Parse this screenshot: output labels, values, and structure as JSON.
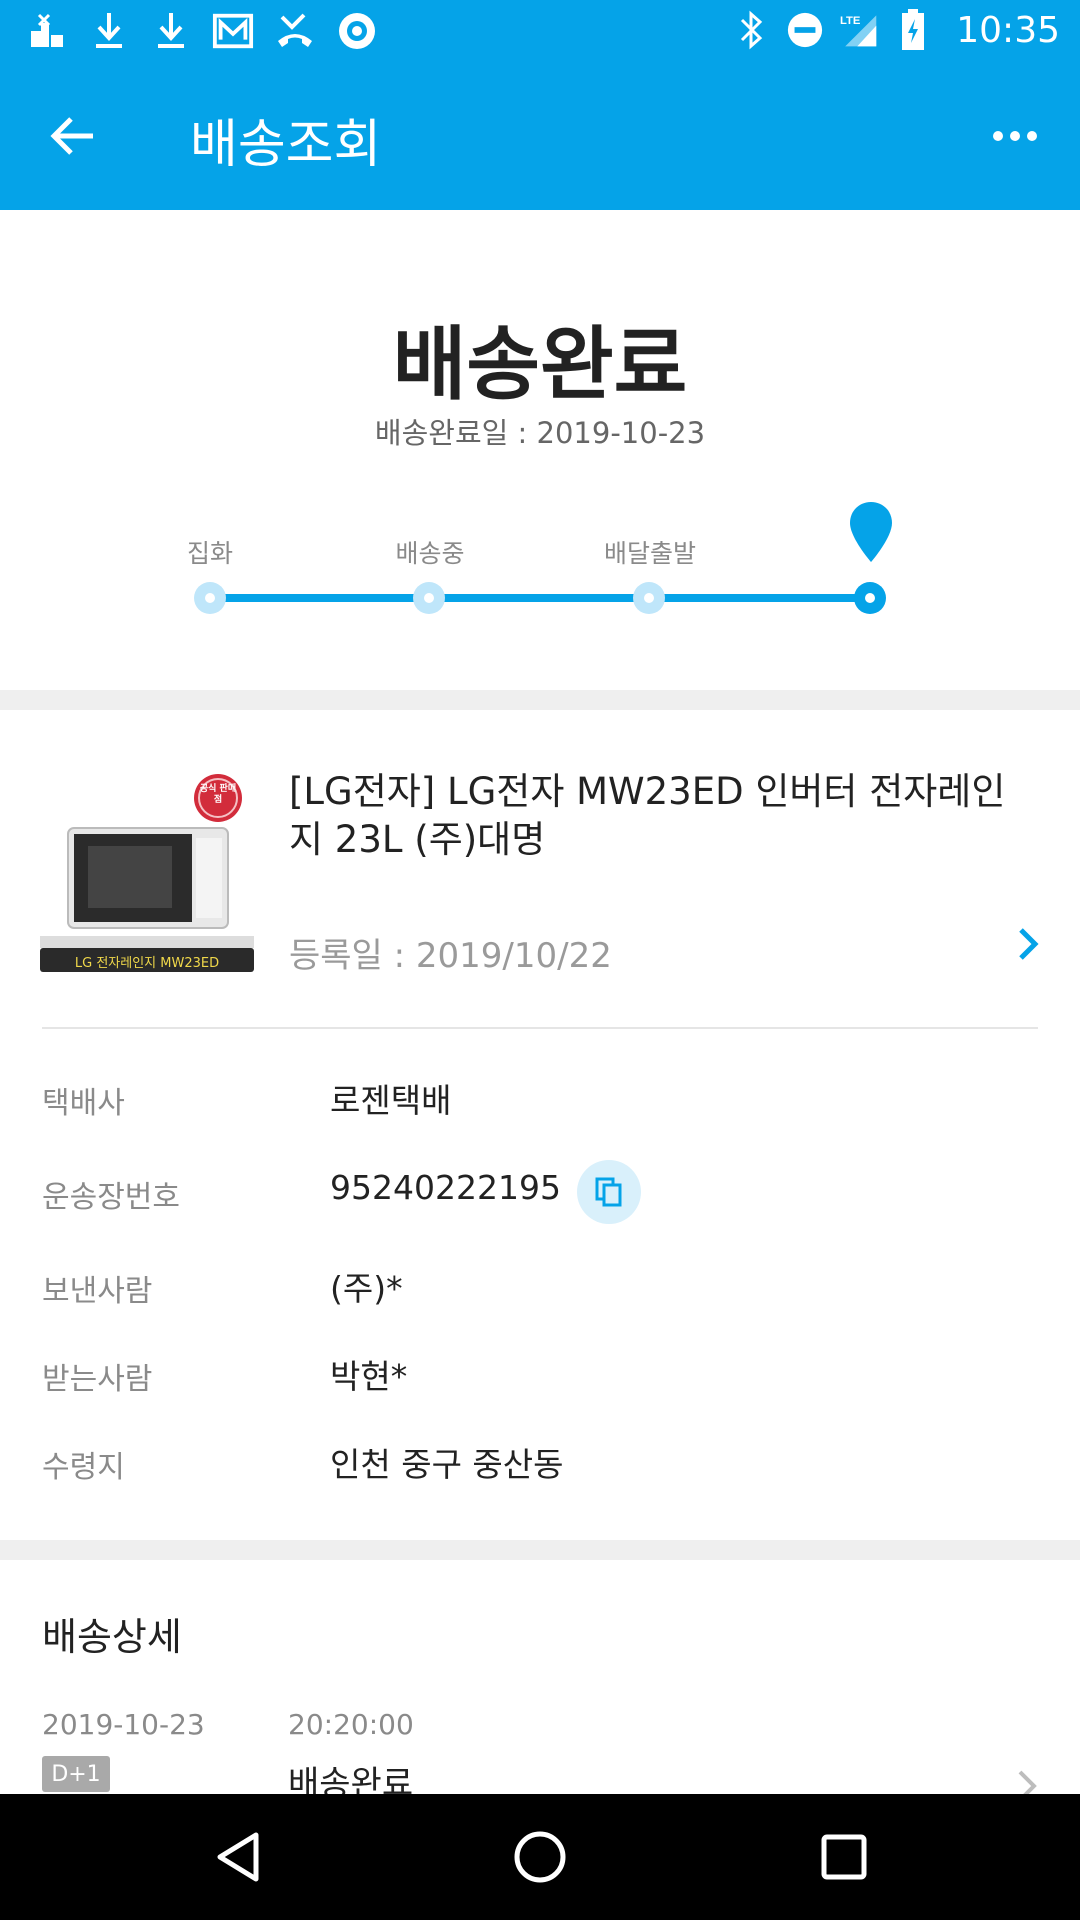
{
  "status_bar": {
    "time": "10:35",
    "left_icons": [
      "app-notification-icon",
      "download-icon",
      "download-icon",
      "mail-icon",
      "missed-call-icon",
      "circle-app-icon"
    ],
    "right_icons": [
      "bluetooth-icon",
      "do-not-disturb-icon",
      "lte-signal-icon",
      "battery-icon"
    ]
  },
  "app_bar": {
    "title": "배송조회",
    "back_icon": "arrow-back-icon",
    "more_icon": "more-horizontal-icon"
  },
  "tracking": {
    "status": "배송완료",
    "completed_date": "배송완료일 : 2019-10-23",
    "steps": [
      {
        "label": "집화",
        "active": false
      },
      {
        "label": "배송중",
        "active": false
      },
      {
        "label": "배달출발",
        "active": false
      },
      {
        "label": "",
        "active": true
      }
    ],
    "accent_color": "#05a3e8"
  },
  "product": {
    "name": "[LG전자] LG전자 MW23ED 인버터 전자레인지 23L (주)대명",
    "registered": "등록일 : 2019/10/22",
    "image_caption": "LG 전자레인지 MW23ED",
    "image_badge": "공식 판매점"
  },
  "info": {
    "courier_label": "택배사",
    "courier_value": "로젠택배",
    "tracking_no_label": "운송장번호",
    "tracking_no_value": "95240222195",
    "sender_label": "보낸사람",
    "sender_value": "(주)*",
    "receiver_label": "받는사람",
    "receiver_value": "박현*",
    "destination_label": "수령지",
    "destination_value": "인천 중구 중산동"
  },
  "detail": {
    "title": "배송상세",
    "rows": [
      {
        "date": "2019-10-23",
        "time": "20:20:00",
        "badge": "D+1",
        "status": "배송완료"
      }
    ]
  },
  "nav_bar": {
    "icons": [
      "back-triangle-icon",
      "home-circle-icon",
      "recents-square-icon"
    ]
  }
}
